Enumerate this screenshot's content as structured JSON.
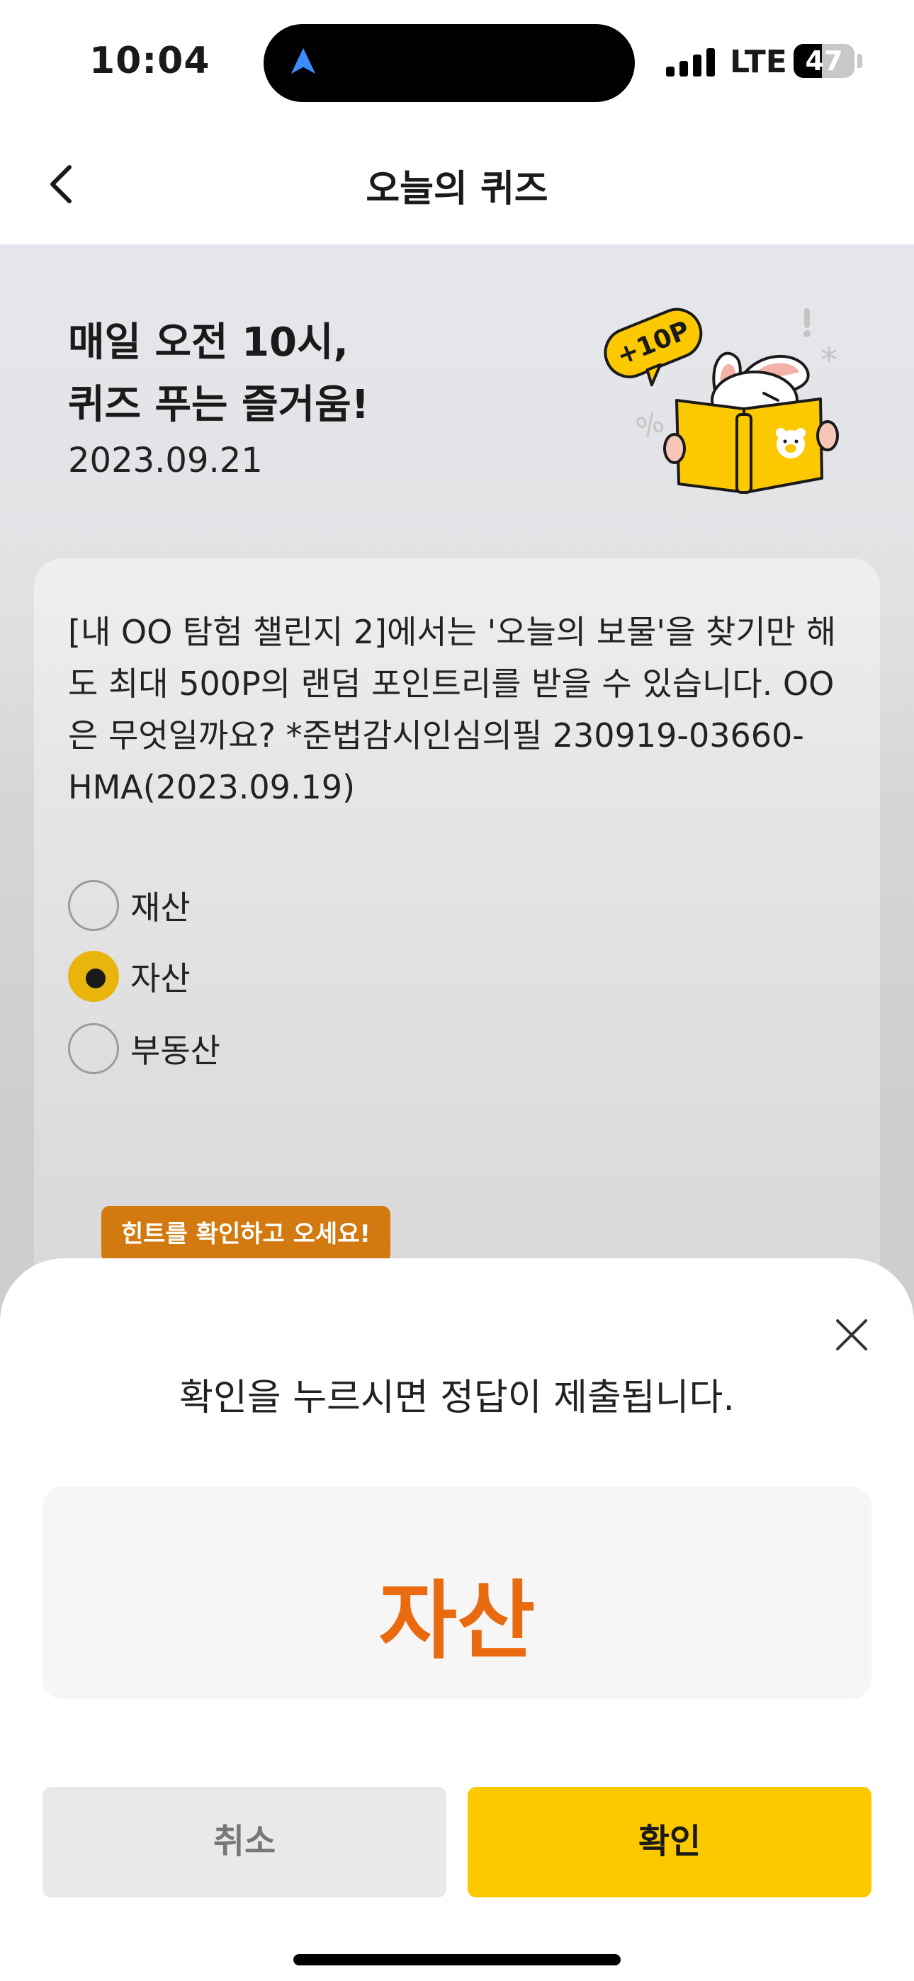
{
  "status_bar": {
    "time": "10:04",
    "network": "LTE",
    "battery": "47",
    "battery_level": 0.47
  },
  "header": {
    "title": "오늘의 퀴즈",
    "back_icon": "chevron-left-icon"
  },
  "hero": {
    "title_line1": "매일 오전 10시,",
    "title_line2": "퀴즈 푸는 즐거움!",
    "date": "2023.09.21",
    "badge": "+10P"
  },
  "question": {
    "text": "[내 OO 탐험 챌린지 2]에서는 '오늘의 보물'을 찾기만 해도 최대 500P의 랜덤 포인트리를 받을 수 있습니다. OO은 무엇일까요? *준법감시인심의필 230919-03660-HMA(2023.09.19)",
    "options": [
      {
        "label": "재산",
        "selected": false
      },
      {
        "label": "자산",
        "selected": true
      },
      {
        "label": "부동산",
        "selected": false
      }
    ],
    "hint": "힌트를 확인하고 오세요!"
  },
  "sheet": {
    "message": "확인을 누르시면 정답이 제출됩니다.",
    "answer": "자산",
    "cancel_label": "취소",
    "confirm_label": "확인"
  },
  "colors": {
    "accent_yellow": "#fcc800",
    "answer_orange": "#ea6a0f",
    "hint_orange": "#d2790f",
    "selected_radio": "#e9b40c"
  }
}
